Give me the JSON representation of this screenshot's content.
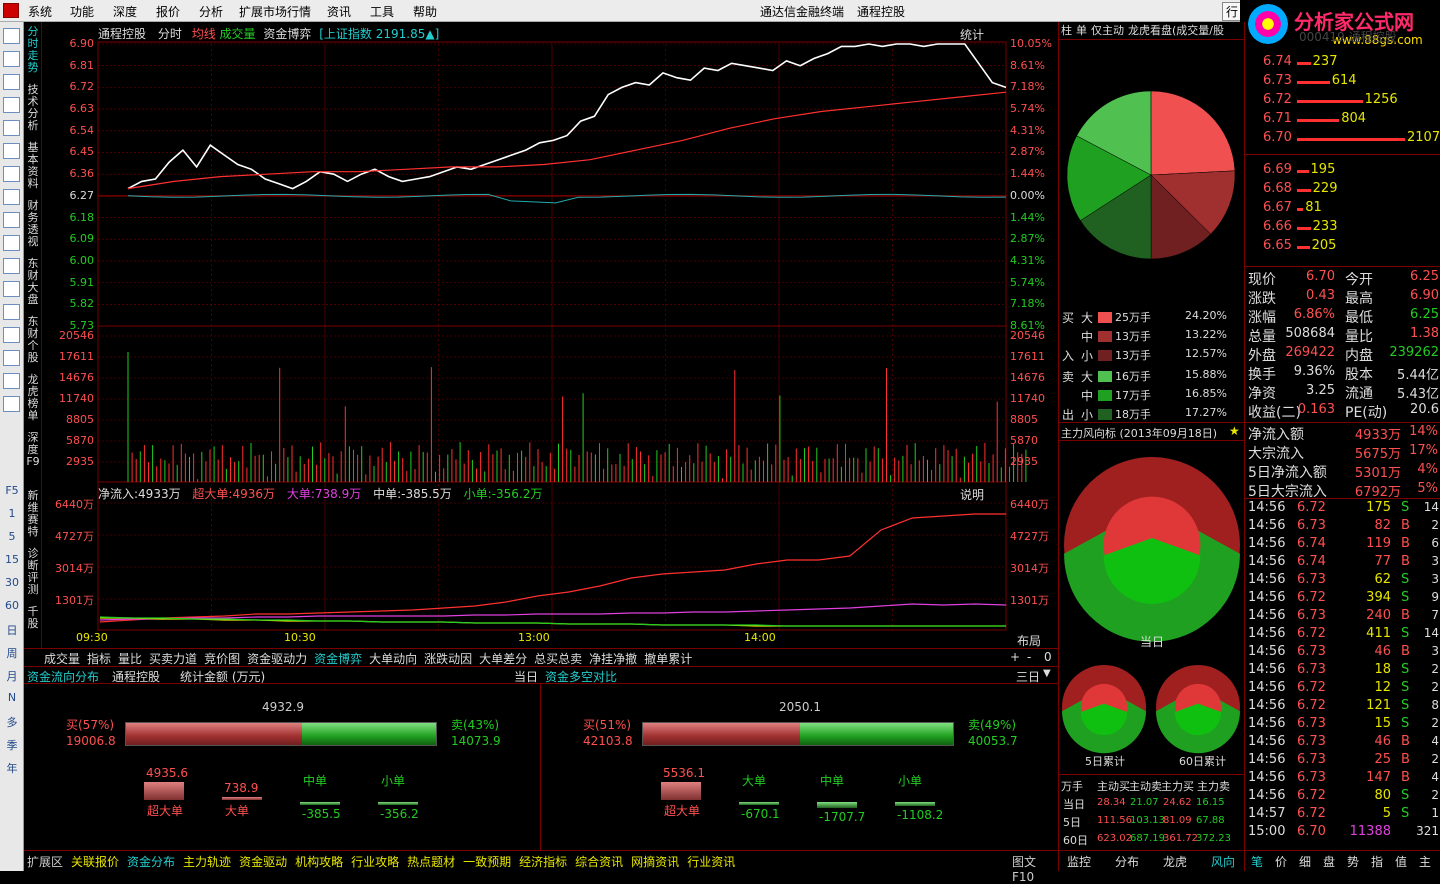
{
  "menu": {
    "items": [
      "系统",
      "功能",
      "深度",
      "报价",
      "分析",
      "扩展市场行情",
      "资讯",
      "工具",
      "帮助"
    ],
    "center_title": "通达信金融终端",
    "stock_name": "通程控股",
    "right_btn": "行",
    "logo_text": "分析家公式网",
    "logo_url": "www.88gs.com"
  },
  "vtabs": [
    "分时走势",
    "技术分析",
    "基本资料",
    "财务透视",
    "东财大盘",
    "东财个股",
    "龙虎榜单",
    "深度F9",
    "新维赛特",
    "诊断评测",
    "千股"
  ],
  "leftbar_icons": [
    "grid-icon",
    "arrow-up-icon",
    "arrow-down-icon",
    "list-icon",
    "table-icon",
    "trend-icon",
    "candle-icon",
    "bars-icon",
    "f10-icon",
    "calendar-icon",
    "f-icon",
    "help-icon",
    "chart-icon",
    "chart2-icon",
    "chart3-icon",
    "percent-icon",
    "pen-icon"
  ],
  "leftbar_labels": [
    "F5",
    "1",
    "5",
    "15",
    "30",
    "60",
    "日",
    "周",
    "月",
    "N",
    "多",
    "季",
    "年"
  ],
  "chart_header": {
    "stock": "通程控股",
    "mode": "分时",
    "avg_label": "均线",
    "vol_label": "成交量",
    "game_label": "资金博弈",
    "index_label": "[上证指数",
    "index_value": "2191.85▲]",
    "stat_label": "统计"
  },
  "price_ticks_left": [
    "6.90",
    "6.81",
    "6.72",
    "6.63",
    "6.54",
    "6.45",
    "6.36",
    "6.27",
    "6.18",
    "6.09",
    "6.00",
    "5.91",
    "5.82",
    "5.73"
  ],
  "pct_ticks_right": [
    "10.05%",
    "8.61%",
    "7.18%",
    "5.74%",
    "4.31%",
    "2.87%",
    "1.44%",
    "0.00%",
    "1.44%",
    "2.87%",
    "4.31%",
    "5.74%",
    "7.18%",
    "8.61%"
  ],
  "vol_ticks": [
    "20546",
    "17611",
    "14676",
    "11740",
    "8805",
    "5870",
    "2935"
  ],
  "flow_header": {
    "net": "净流入:4933万",
    "super": "超大单:4936万",
    "big": "大单:738.9万",
    "mid": "中单:-385.5万",
    "small": "小单:-356.2万",
    "note": "说明"
  },
  "flow_ticks": [
    "6440万",
    "4727万",
    "3014万",
    "1301万"
  ],
  "time_ticks": [
    "09:30",
    "10:30",
    "13:00",
    "14:00"
  ],
  "layout_label": "布局",
  "lower_tabs": [
    "成交量",
    "指标",
    "量比",
    "买卖力道",
    "竞价图",
    "资金驱动力",
    "资金博弈",
    "大单动向",
    "涨跌动因",
    "大单差分",
    "总买总卖",
    "净挂净撤",
    "撤单累计"
  ],
  "lower_tab_active": "资金博弈",
  "zoom": {
    "plus": "+",
    "minus": "-",
    "zero": "0"
  },
  "panel": {
    "title1": "资金流向分布",
    "stock": "通程控股",
    "unit": "统计金额 (万元)",
    "day1": "当日",
    "title2": "资金多空对比",
    "day3": "三日",
    "left": {
      "total": "4932.9",
      "buy_label": "买(57%)",
      "buy_val": "19006.8",
      "sell_label": "卖(43%)",
      "sell_val": "14073.9",
      "bars": [
        {
          "val": "4935.6",
          "label": "超大单"
        },
        {
          "val": "738.9",
          "label": "大单"
        },
        {
          "val": "-385.5",
          "label": "中单"
        },
        {
          "val": "-356.2",
          "label": "小单"
        }
      ]
    },
    "right": {
      "total": "2050.1",
      "buy_label": "买(51%)",
      "buy_val": "42103.8",
      "sell_label": "卖(49%)",
      "sell_val": "40053.7",
      "bars": [
        {
          "val": "5536.1",
          "label": "超大单"
        },
        {
          "val": "-670.1",
          "label": "大单"
        },
        {
          "val": "-1707.7",
          "label": "中单"
        },
        {
          "val": "-1108.2",
          "label": "小单"
        }
      ]
    }
  },
  "bottom_tabs": [
    "扩展区",
    "关联报价",
    "资金分布",
    "主力轨迹",
    "资金驱动",
    "机构攻略",
    "行业攻略",
    "热点题材",
    "一致预期",
    "经济指标",
    "综合资讯",
    "网摘资讯",
    "行业资讯"
  ],
  "bottom_tab_active": "资金分布",
  "bottom_right": "图文F10",
  "mid": {
    "tabs": [
      "柱",
      "单",
      "仅主动",
      "龙虎看盘(成交量/股"
    ],
    "legend": [
      {
        "side": "买",
        "size": "大",
        "lots": "25万手",
        "pct": "24.20%"
      },
      {
        "side": "",
        "size": "中",
        "lots": "13万手",
        "pct": "13.22%"
      },
      {
        "side": "入",
        "size": "小",
        "lots": "13万手",
        "pct": "12.57%"
      },
      {
        "side": "卖",
        "size": "大",
        "lots": "16万手",
        "pct": "15.88%"
      },
      {
        "side": "",
        "size": "中",
        "lots": "17万手",
        "pct": "16.85%"
      },
      {
        "side": "出",
        "size": "小",
        "lots": "18万手",
        "pct": "17.27%"
      }
    ],
    "wind_title": "主力风向标 (2013年09月18日)",
    "day_label": "当日",
    "five_label": "5日累计",
    "sixty_label": "60日累计",
    "table_head": [
      "万手",
      "主动买",
      "主动卖",
      "主力买",
      "主力卖"
    ],
    "table_rows": [
      {
        "k": "当日",
        "v": [
          "28.34",
          "21.07",
          "24.62",
          "16.15"
        ]
      },
      {
        "k": "5日",
        "v": [
          "111.56",
          "103.13",
          "81.09",
          "67.88"
        ]
      },
      {
        "k": "60日",
        "v": [
          "623.02",
          "687.19",
          "361.72",
          "372.23"
        ]
      }
    ],
    "foot_tabs": [
      "监控",
      "分布",
      "龙虎",
      "风向"
    ],
    "foot_active": "风向"
  },
  "right": {
    "watermark": "000419 通程控股",
    "asks": [
      {
        "p": "6.74",
        "v": "237",
        "w": 0.11
      },
      {
        "p": "6.73",
        "v": "614",
        "w": 0.29
      },
      {
        "p": "6.72",
        "v": "1256",
        "w": 0.6
      },
      {
        "p": "6.71",
        "v": "804",
        "w": 0.38
      },
      {
        "p": "6.70",
        "v": "2107",
        "w": 1.0
      }
    ],
    "bids": [
      {
        "p": "6.69",
        "v": "195",
        "w": 0.09
      },
      {
        "p": "6.68",
        "v": "229",
        "w": 0.11
      },
      {
        "p": "6.67",
        "v": "81",
        "w": 0.04
      },
      {
        "p": "6.66",
        "v": "233",
        "w": 0.11
      },
      {
        "p": "6.65",
        "v": "205",
        "w": 0.1
      }
    ],
    "quote": [
      [
        "现价",
        "6.70",
        "今开",
        "6.25"
      ],
      [
        "涨跌",
        "0.43",
        "最高",
        "6.90"
      ],
      [
        "涨幅",
        "6.86%",
        "最低",
        "6.25"
      ],
      [
        "总量",
        "508684",
        "量比",
        "1.38"
      ],
      [
        "外盘",
        "269422",
        "内盘",
        "239262"
      ],
      [
        "换手",
        "9.36%",
        "股本",
        "5.44亿"
      ],
      [
        "净资",
        "3.25",
        "流通",
        "5.43亿"
      ],
      [
        "收益(二)",
        "0.163",
        "PE(动)",
        "20.6"
      ]
    ],
    "flow": [
      [
        "净流入额",
        "4933万",
        "14%"
      ],
      [
        "大宗流入",
        "5675万",
        "17%"
      ],
      [
        "5日净流入额",
        "5301万",
        "4%"
      ],
      [
        "5日大宗流入",
        "6792万",
        "5%"
      ]
    ],
    "ticks": [
      [
        "14:56",
        "6.72",
        "175",
        "S",
        "14"
      ],
      [
        "14:56",
        "6.73",
        "82",
        "B",
        "2"
      ],
      [
        "14:56",
        "6.74",
        "119",
        "B",
        "6"
      ],
      [
        "14:56",
        "6.74",
        "77",
        "B",
        "3"
      ],
      [
        "14:56",
        "6.73",
        "62",
        "S",
        "3"
      ],
      [
        "14:56",
        "6.72",
        "394",
        "S",
        "9"
      ],
      [
        "14:56",
        "6.73",
        "240",
        "B",
        "7"
      ],
      [
        "14:56",
        "6.72",
        "411",
        "S",
        "14"
      ],
      [
        "14:56",
        "6.73",
        "46",
        "B",
        "3"
      ],
      [
        "14:56",
        "6.73",
        "18",
        "S",
        "2"
      ],
      [
        "14:56",
        "6.72",
        "12",
        "S",
        "2"
      ],
      [
        "14:56",
        "6.72",
        "121",
        "S",
        "8"
      ],
      [
        "14:56",
        "6.73",
        "15",
        "S",
        "2"
      ],
      [
        "14:56",
        "6.73",
        "46",
        "B",
        "4"
      ],
      [
        "14:56",
        "6.73",
        "25",
        "B",
        "2"
      ],
      [
        "14:56",
        "6.73",
        "147",
        "B",
        "4"
      ],
      [
        "14:56",
        "6.72",
        "80",
        "S",
        "2"
      ],
      [
        "14:57",
        "6.72",
        "5",
        "S",
        "1"
      ],
      [
        "15:00",
        "6.70",
        "11388",
        "",
        "321"
      ]
    ],
    "foot_tabs": [
      "笔",
      "价",
      "细",
      "盘",
      "势",
      "指",
      "值",
      "主"
    ],
    "foot_active": "笔"
  },
  "colors": {
    "up": "#ff5050",
    "down": "#22cc22",
    "grid": "#7a0000",
    "price": "#ffffff",
    "avg": "#22aaaa"
  }
}
